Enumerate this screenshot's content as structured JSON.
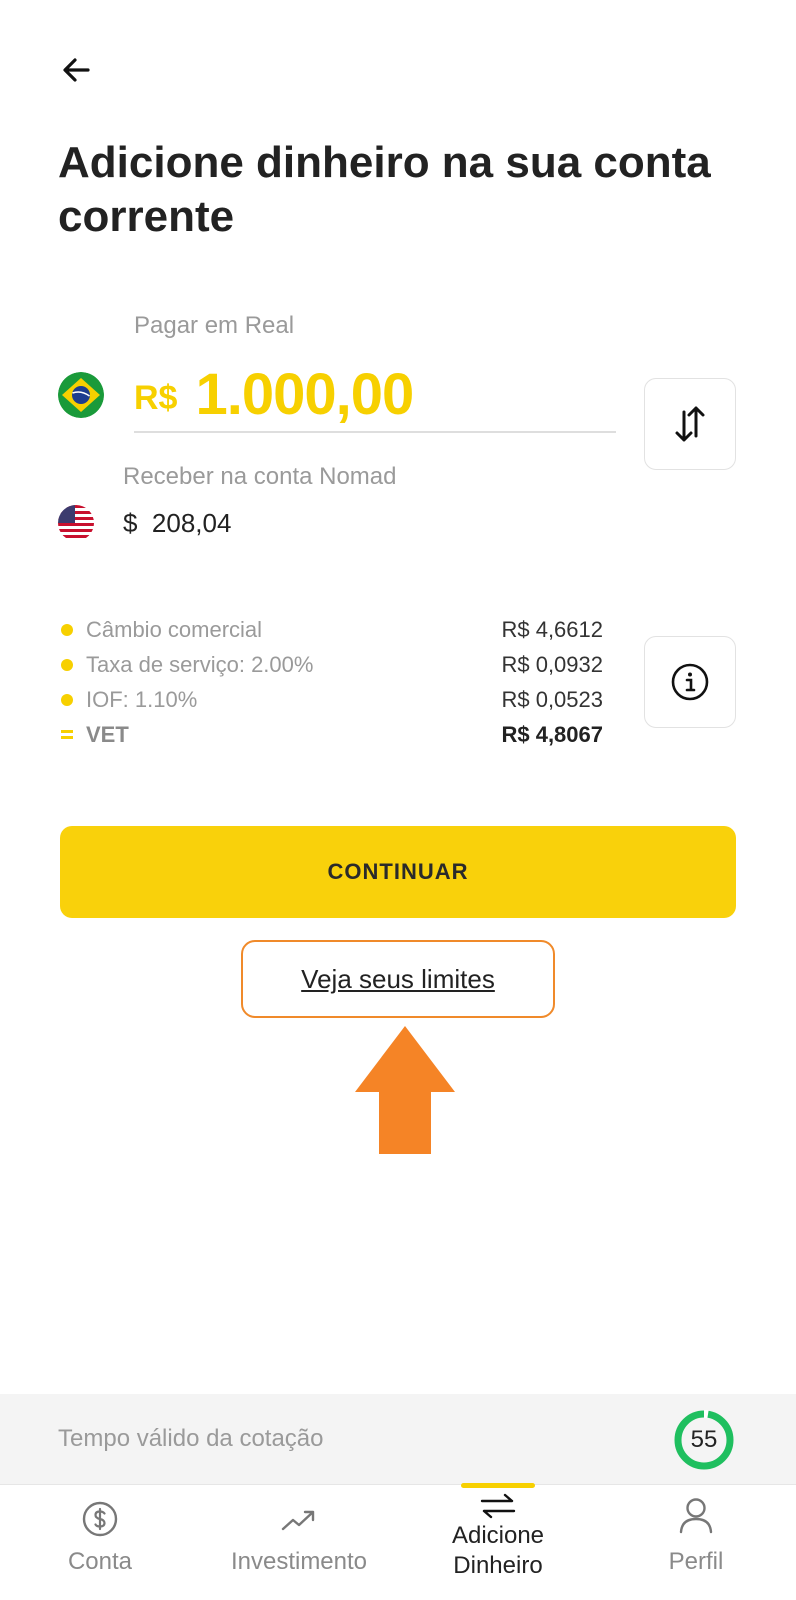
{
  "header": {
    "back_icon": "arrow-left-icon",
    "title": "Adicione dinheiro na sua conta corrente"
  },
  "pay": {
    "label": "Pagar em Real",
    "currency": "R$",
    "amount": "1.000,00",
    "flag_icon": "brazil-flag-icon"
  },
  "receive": {
    "label": "Receber na conta Nomad",
    "value": "$  208,04",
    "flag_icon": "usa-flag-icon"
  },
  "swap_icon": "swap-arrows-icon",
  "rates": [
    {
      "label": "Câmbio comercial",
      "value": "R$ 4,6612"
    },
    {
      "label": "Taxa de serviço: 2.00%",
      "value": "R$ 0,0932"
    },
    {
      "label": "IOF: 1.10%",
      "value": "R$ 0,0523"
    },
    {
      "label": "VET",
      "value": "R$ 4,8067"
    }
  ],
  "info_icon": "info-icon",
  "continue_label": "CONTINUAR",
  "limits_link": "Veja seus limites",
  "quote": {
    "label": "Tempo válido da cotação",
    "seconds": "55"
  },
  "nav": [
    {
      "label": "Conta",
      "icon": "dollar-circle-icon"
    },
    {
      "label": "Investimento",
      "icon": "trending-up-icon"
    },
    {
      "label": "Adicione\nDinheiro",
      "icon": "swap-horizontal-icon"
    },
    {
      "label": "Perfil",
      "icon": "user-icon"
    }
  ],
  "colors": {
    "accent": "#F9D10B",
    "annotation": "#F58426",
    "timer": "#1FBF5F"
  }
}
